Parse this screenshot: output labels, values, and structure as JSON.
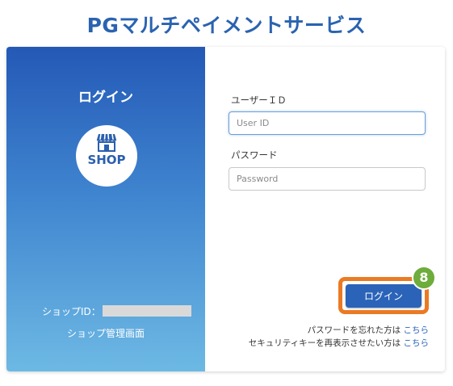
{
  "header": {
    "title": "PGマルチペイメントサービス"
  },
  "left_panel": {
    "title": "ログイン",
    "badge_text": "SHOP",
    "badge_icon": "storefront-icon",
    "shop_id_label": "ショップID：",
    "admin_label": "ショップ管理画面"
  },
  "form": {
    "user_id_label": "ユーザーＩＤ",
    "user_id_placeholder": "User ID",
    "user_id_value": "",
    "password_label": "パスワード",
    "password_placeholder": "Password",
    "password_value": "",
    "login_button": "ログイン"
  },
  "annotation": {
    "step_number": "8",
    "highlight_color": "#ea7a24",
    "badge_color": "#6eac3b"
  },
  "help": {
    "forgot_password_text": "パスワードを忘れた方は",
    "forgot_password_link": "こちら",
    "security_key_text": "セキュリティキーを再表示させたい方は",
    "security_key_link": "こちら"
  },
  "colors": {
    "brand": "#2a63b0",
    "panel_top": "#2459b6",
    "panel_bottom": "#6db9e4",
    "button": "#2a63b8"
  }
}
